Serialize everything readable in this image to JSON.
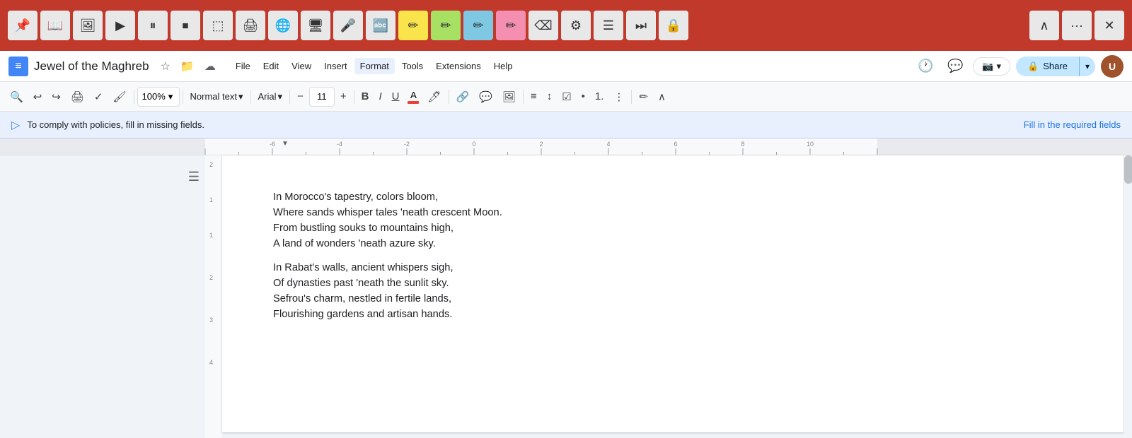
{
  "topToolbar": {
    "buttons": [
      {
        "name": "pin-icon",
        "symbol": "📌"
      },
      {
        "name": "book-icon",
        "symbol": "📖"
      },
      {
        "name": "image-icon",
        "symbol": "🖼"
      },
      {
        "name": "play-icon",
        "symbol": "▶"
      },
      {
        "name": "pause-icon",
        "symbol": "⏸"
      },
      {
        "name": "stop-icon",
        "symbol": "⏹"
      },
      {
        "name": "select-icon",
        "symbol": "⬚"
      },
      {
        "name": "print-icon",
        "symbol": "🖨"
      },
      {
        "name": "globe-icon",
        "symbol": "🌐"
      },
      {
        "name": "monitor-icon",
        "symbol": "🖥"
      },
      {
        "name": "mic-icon",
        "symbol": "🎤"
      },
      {
        "name": "translate-icon",
        "symbol": "🔤"
      },
      {
        "name": "pen-yellow-icon",
        "symbol": "✏",
        "class": "highlight-yellow"
      },
      {
        "name": "pen-green-icon",
        "symbol": "✏",
        "class": "highlight-green"
      },
      {
        "name": "pen-blue-icon",
        "symbol": "✏",
        "class": "highlight-blue"
      },
      {
        "name": "pen-pink-icon",
        "symbol": "✏",
        "class": "highlight-pink"
      },
      {
        "name": "eraser-icon",
        "symbol": "⌫"
      },
      {
        "name": "settings-icon",
        "symbol": "⚙"
      },
      {
        "name": "list-icon",
        "symbol": "☰"
      },
      {
        "name": "next-icon",
        "symbol": "⏭"
      },
      {
        "name": "lock-icon",
        "symbol": "🔒"
      }
    ],
    "rightButtons": [
      {
        "name": "collapse-icon",
        "symbol": "∧"
      },
      {
        "name": "more-icon",
        "symbol": "···"
      },
      {
        "name": "close-icon",
        "symbol": "✕"
      }
    ]
  },
  "header": {
    "title": "Jewel of the Maghreb",
    "menuItems": [
      {
        "label": "File",
        "name": "menu-file"
      },
      {
        "label": "Edit",
        "name": "menu-edit"
      },
      {
        "label": "View",
        "name": "menu-view"
      },
      {
        "label": "Insert",
        "name": "menu-insert"
      },
      {
        "label": "Format",
        "name": "menu-format",
        "active": true
      },
      {
        "label": "Tools",
        "name": "menu-tools"
      },
      {
        "label": "Extensions",
        "name": "menu-extensions"
      },
      {
        "label": "Help",
        "name": "menu-help"
      }
    ],
    "shareLabel": "Share",
    "avatarInitial": "U"
  },
  "formatToolbar": {
    "zoom": "100%",
    "style": "Normal text",
    "font": "Arial",
    "fontSize": "11",
    "boldLabel": "B",
    "italicLabel": "I",
    "underlineLabel": "U"
  },
  "policyBanner": {
    "text": "To comply with policies, fill in missing fields.",
    "linkText": "Fill in the required fields"
  },
  "document": {
    "paragraphs": [
      {
        "lines": [
          "In Morocco's tapestry, colors bloom,",
          "Where sands whisper tales 'neath crescent Moon.",
          "From bustling souks to mountains high,",
          "A land of wonders 'neath azure sky."
        ]
      },
      {
        "lines": [
          "In Rabat's walls, ancient whispers sigh,",
          "Of dynasties past 'neath the sunlit sky.",
          "Sefrou's charm, nestled in fertile lands,",
          "Flourishing gardens and artisan hands."
        ]
      }
    ]
  }
}
